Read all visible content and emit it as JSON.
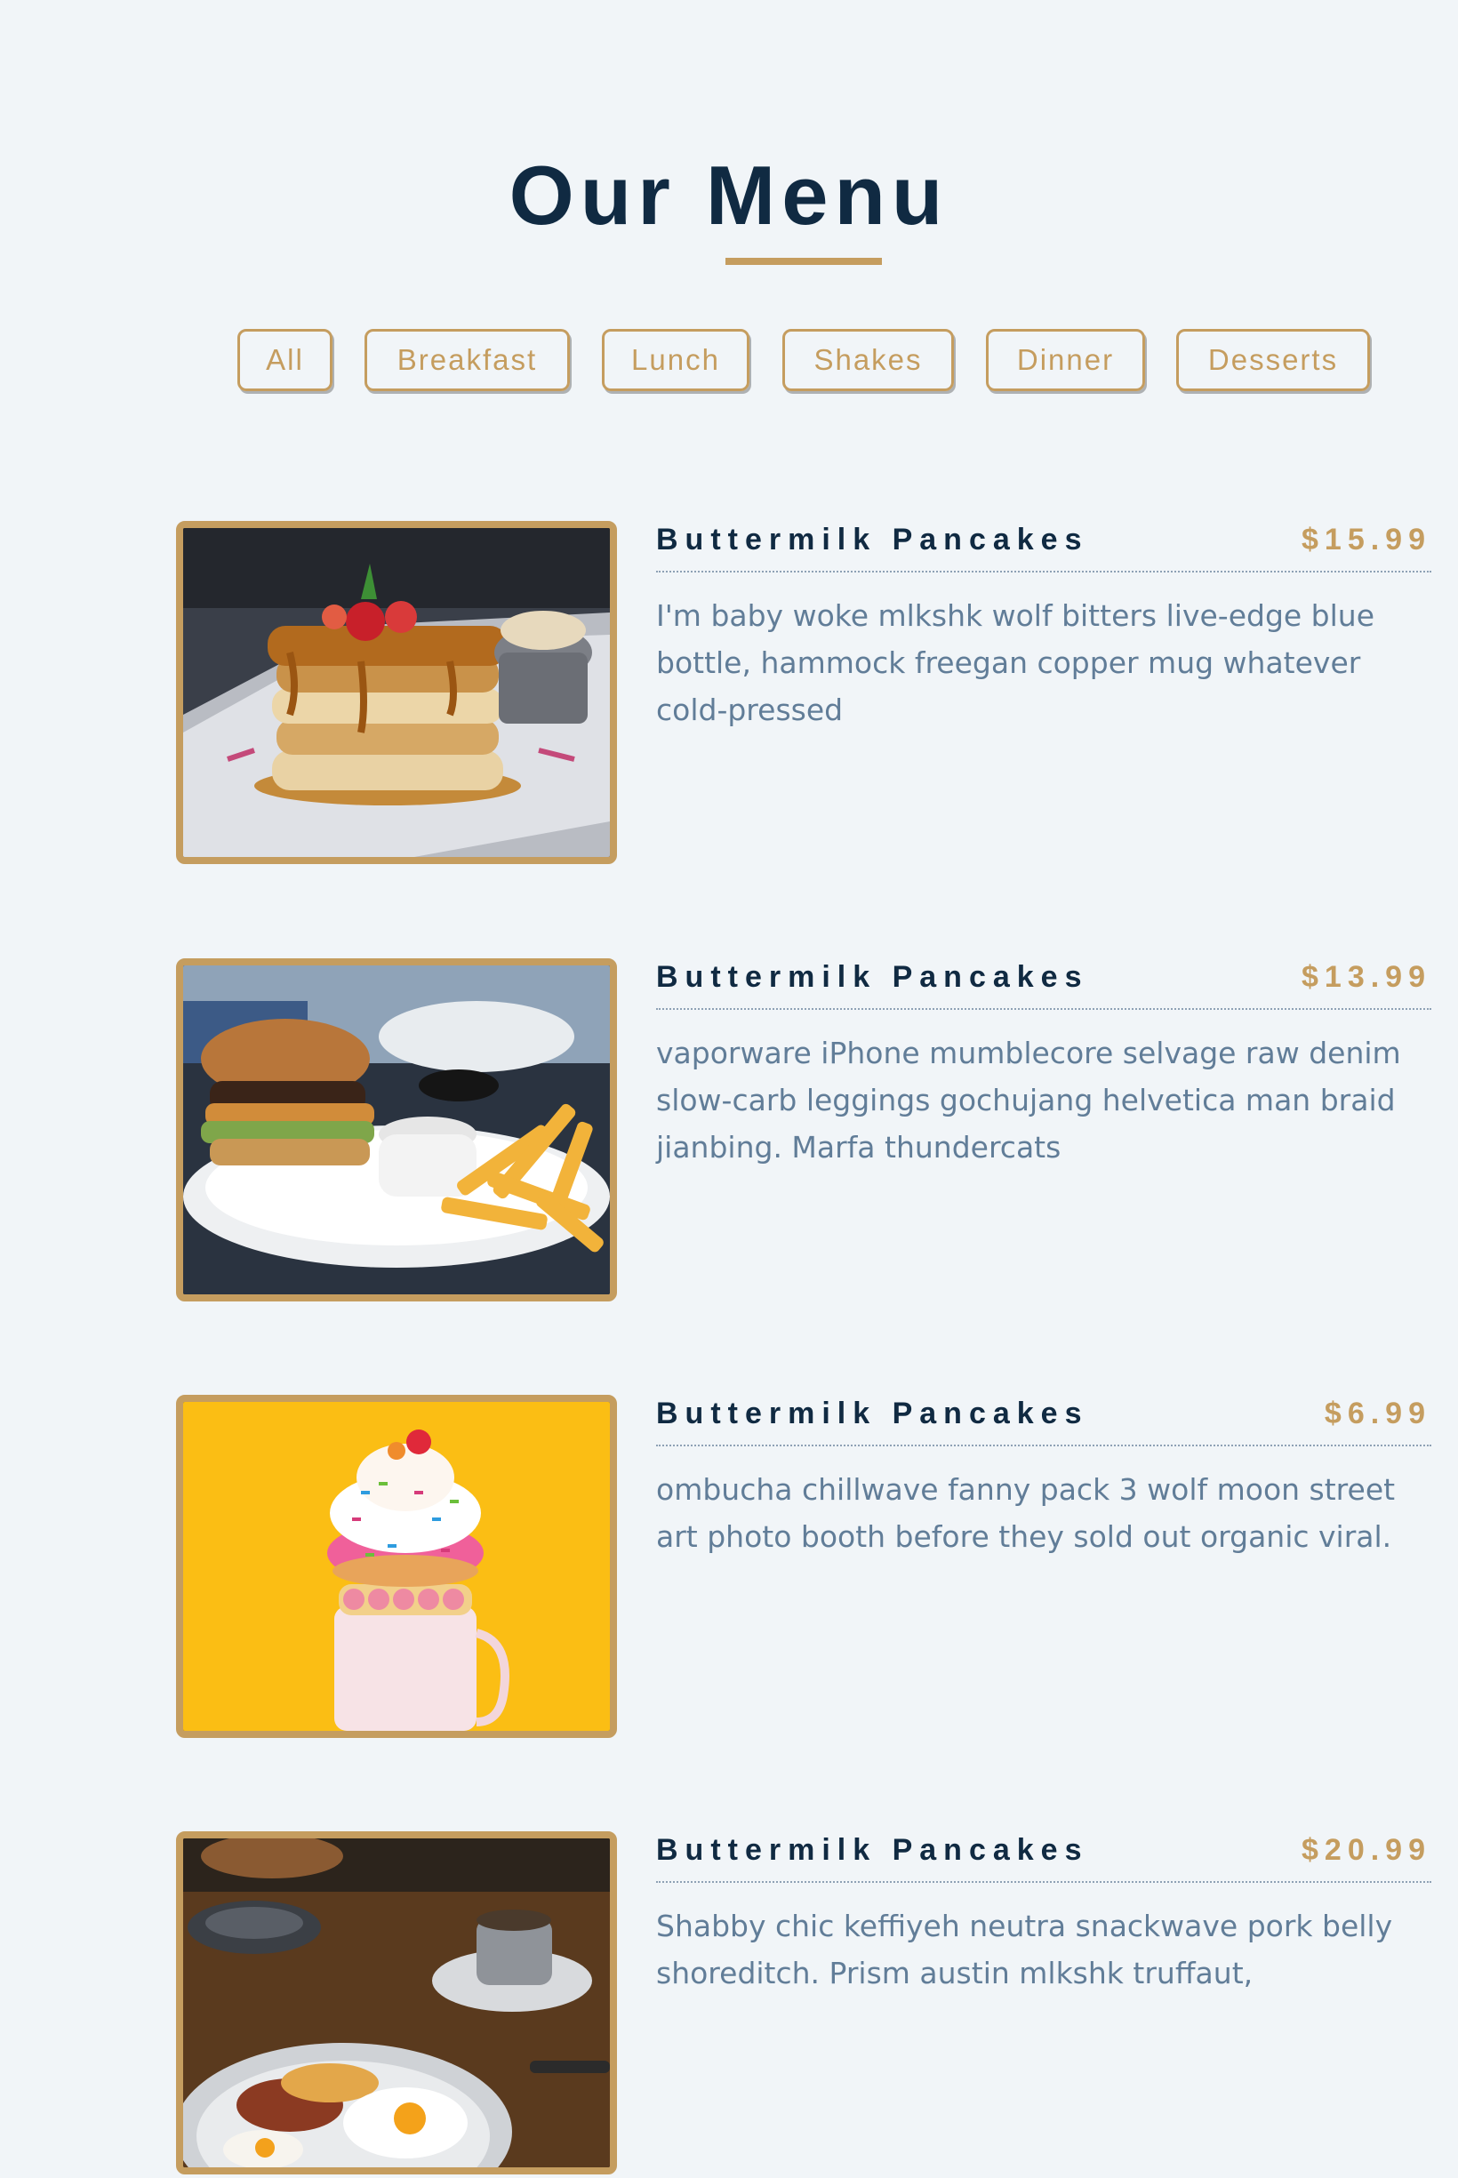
{
  "page": {
    "title": "Our Menu"
  },
  "filters": [
    {
      "label": "All"
    },
    {
      "label": "Breakfast"
    },
    {
      "label": "Lunch"
    },
    {
      "label": "Shakes"
    },
    {
      "label": "Dinner"
    },
    {
      "label": "Desserts"
    }
  ],
  "menu_items": [
    {
      "name": "Buttermilk Pancakes",
      "price": "$15.99",
      "description": "I'm baby woke mlkshk wolf bitters live-edge blue bottle, hammock freegan copper mug whatever cold-pressed",
      "photo": "pancakes-photo"
    },
    {
      "name": "Buttermilk Pancakes",
      "price": "$13.99",
      "description": "vaporware iPhone mumblecore selvage raw denim slow-carb leggings gochujang helvetica man braid jianbing. Marfa thundercats",
      "photo": "burger-photo"
    },
    {
      "name": "Buttermilk Pancakes",
      "price": "$6.99",
      "description": "ombucha chillwave fanny pack 3 wolf moon street art photo booth before they sold out organic viral.",
      "photo": "milkshake-photo"
    },
    {
      "name": "Buttermilk Pancakes",
      "price": "$20.99",
      "description": "Shabby chic keffiyeh neutra snackwave pork belly shoreditch. Prism austin mlkshk truffaut,",
      "photo": "breakfast-photo"
    }
  ],
  "colors": {
    "accent": "#c59d5f",
    "heading": "#102a42",
    "text": "#617d98",
    "background": "#f1f5f8"
  }
}
